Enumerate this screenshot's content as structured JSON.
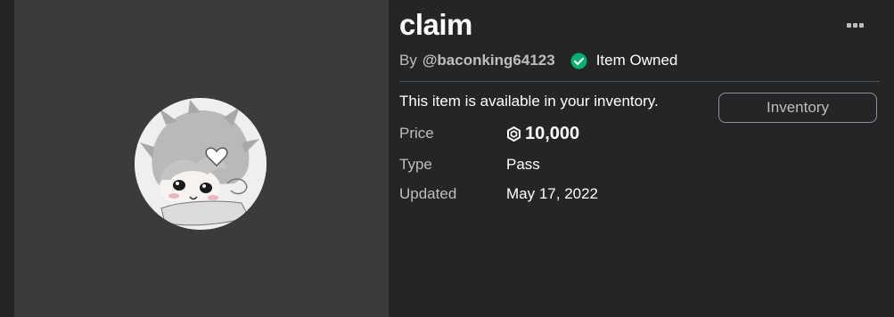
{
  "item": {
    "title": "claim",
    "by_label": "By",
    "creator": "@baconking64123",
    "owned_label": "Item Owned",
    "availability_text": "This item is available in your inventory.",
    "inventory_button": "Inventory"
  },
  "details": {
    "price_label": "Price",
    "price_value": "10,000",
    "type_label": "Type",
    "type_value": "Pass",
    "updated_label": "Updated",
    "updated_value": "May 17, 2022"
  },
  "icons": {
    "owned": "check-circle-icon",
    "currency": "robux-icon",
    "more": "more-options-icon"
  },
  "colors": {
    "background": "#232527",
    "thumbnail_panel": "#393b3d",
    "owned_green": "#00b06f",
    "muted_text": "#bdbebe",
    "divider": "#4f5255"
  }
}
